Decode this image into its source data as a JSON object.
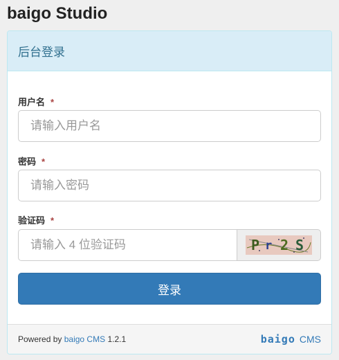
{
  "brand": "baigo Studio",
  "panel": {
    "title": "后台登录"
  },
  "form": {
    "username_label": "用户名",
    "username_placeholder": "请输入用户名",
    "password_label": "密码",
    "password_placeholder": "请输入密码",
    "captcha_label": "验证码",
    "captcha_placeholder": "请输入 4 位验证码",
    "required_mark": "*",
    "captcha_chars": [
      "P",
      "r",
      "2",
      "S"
    ],
    "submit_label": "登录"
  },
  "footer": {
    "powered_by": "Powered by",
    "link_text": "baigo CMS",
    "version": "1.2.1",
    "logo_text": "baigo",
    "logo_cms": "CMS"
  },
  "colors": {
    "primary": "#337ab7",
    "heading_bg": "#d9edf7",
    "heading_text": "#31708f",
    "required": "#a94442"
  }
}
